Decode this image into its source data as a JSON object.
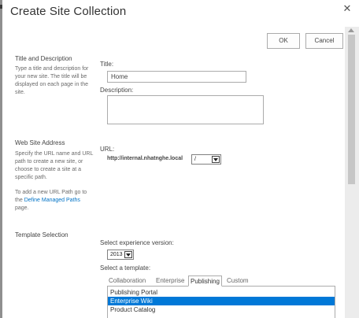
{
  "dialog": {
    "title": "Create Site Collection",
    "ok_label": "OK",
    "cancel_label": "Cancel",
    "close_icon": "close-icon"
  },
  "title_section": {
    "heading": "Title and Description",
    "description": "Type a title and description for your new site. The title will be displayed on each page in the site.",
    "title_label": "Title:",
    "title_value": "Home",
    "description_label": "Description:",
    "description_value": ""
  },
  "address_section": {
    "heading": "Web Site Address",
    "description": "Specify the URL name and URL path to create a new site, or choose to create a site at a specific path.",
    "managed_paths_prefix": "To add a new URL Path go to the ",
    "managed_paths_link": "Define Managed Paths",
    "managed_paths_suffix": " page.",
    "url_label": "URL:",
    "url_prefix": "http://internal.nhatnghe.local",
    "url_path_value": "/"
  },
  "template_section": {
    "heading": "Template Selection",
    "experience_label": "Select experience version:",
    "experience_value": "2013",
    "template_label": "Select a template:",
    "tabs": [
      {
        "label": "Collaboration",
        "active": false
      },
      {
        "label": "Enterprise",
        "active": false
      },
      {
        "label": "Publishing",
        "active": true
      },
      {
        "label": "Custom",
        "active": false
      }
    ],
    "templates": [
      {
        "label": "Publishing Portal",
        "selected": false
      },
      {
        "label": "Enterprise Wiki",
        "selected": true
      },
      {
        "label": "Product Catalog",
        "selected": false
      }
    ]
  },
  "colors": {
    "accent": "#0072c6",
    "selection": "#0078d7"
  }
}
